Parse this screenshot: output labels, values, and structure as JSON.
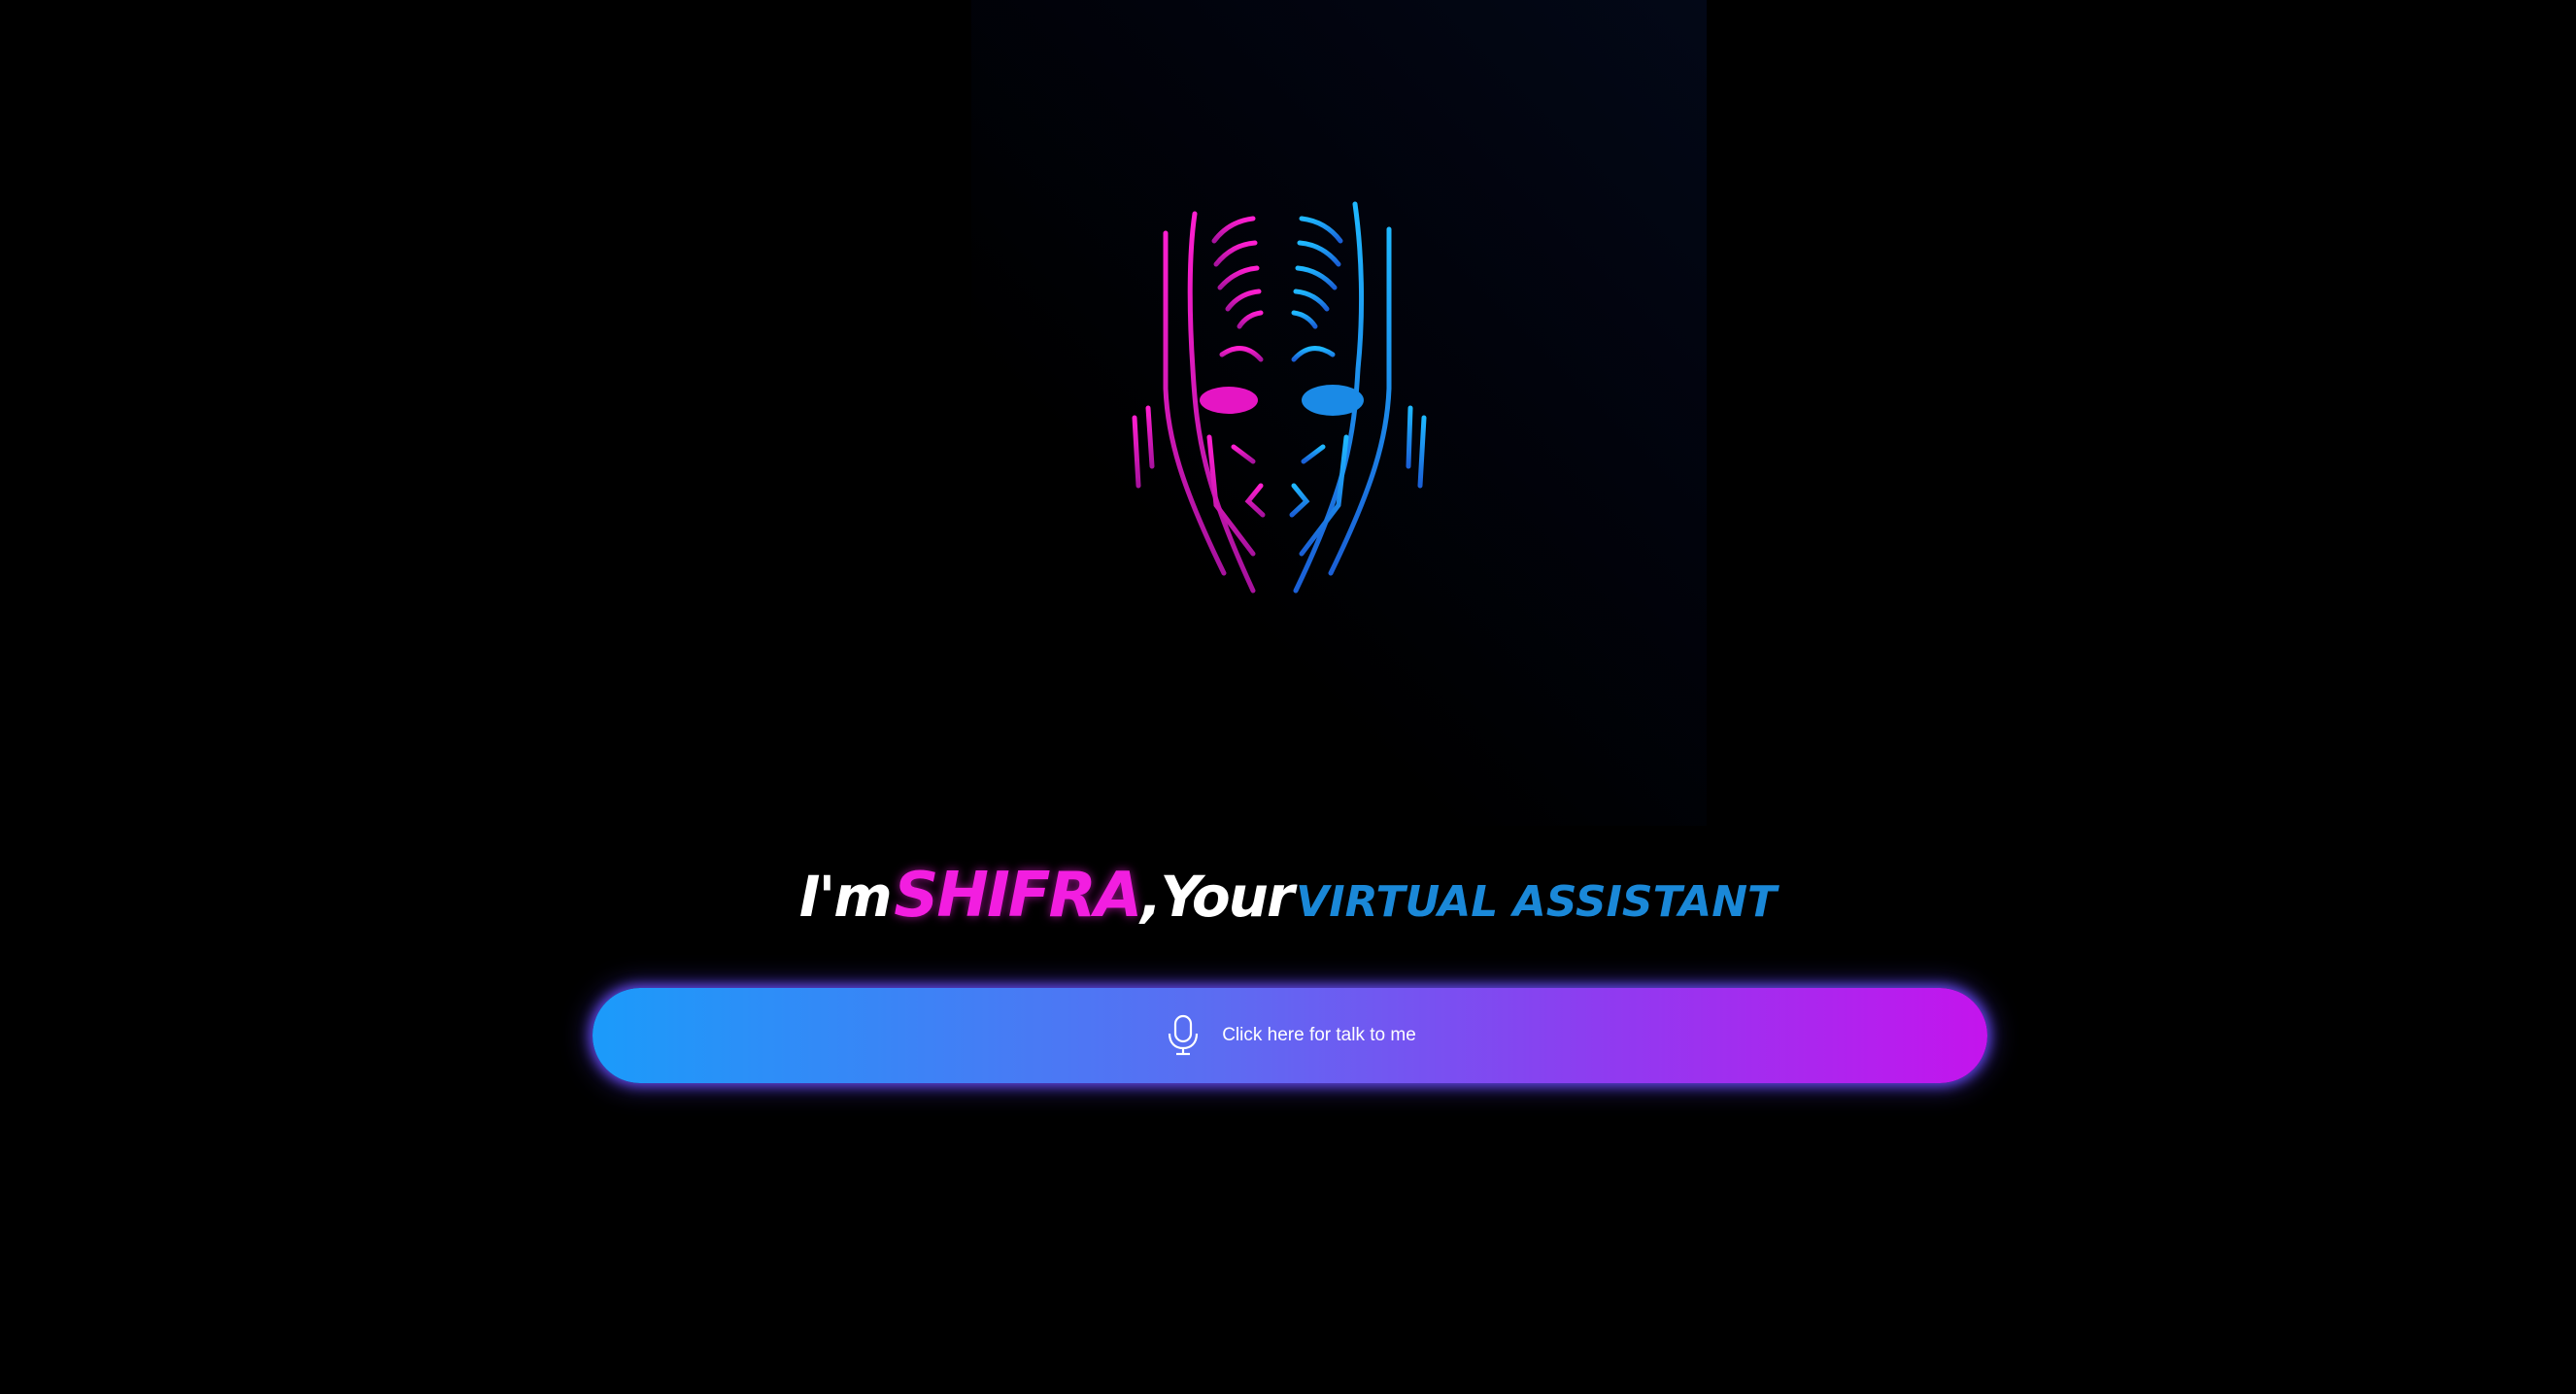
{
  "hero": {
    "logo_icon": "robot-face-icon",
    "colors": {
      "magenta": "#f21ee0",
      "blue": "#1a88d8"
    }
  },
  "headline": {
    "intro": "I'm",
    "name": "SHIFRA",
    "middle": ",Your",
    "role": "VIRTUAL ASSISTANT"
  },
  "talk_button": {
    "icon": "microphone-icon",
    "label": "Click here for talk to me",
    "gradient": [
      "#1b9bfa",
      "#5c6cf2",
      "#8e3cf0",
      "#c414ed"
    ]
  }
}
